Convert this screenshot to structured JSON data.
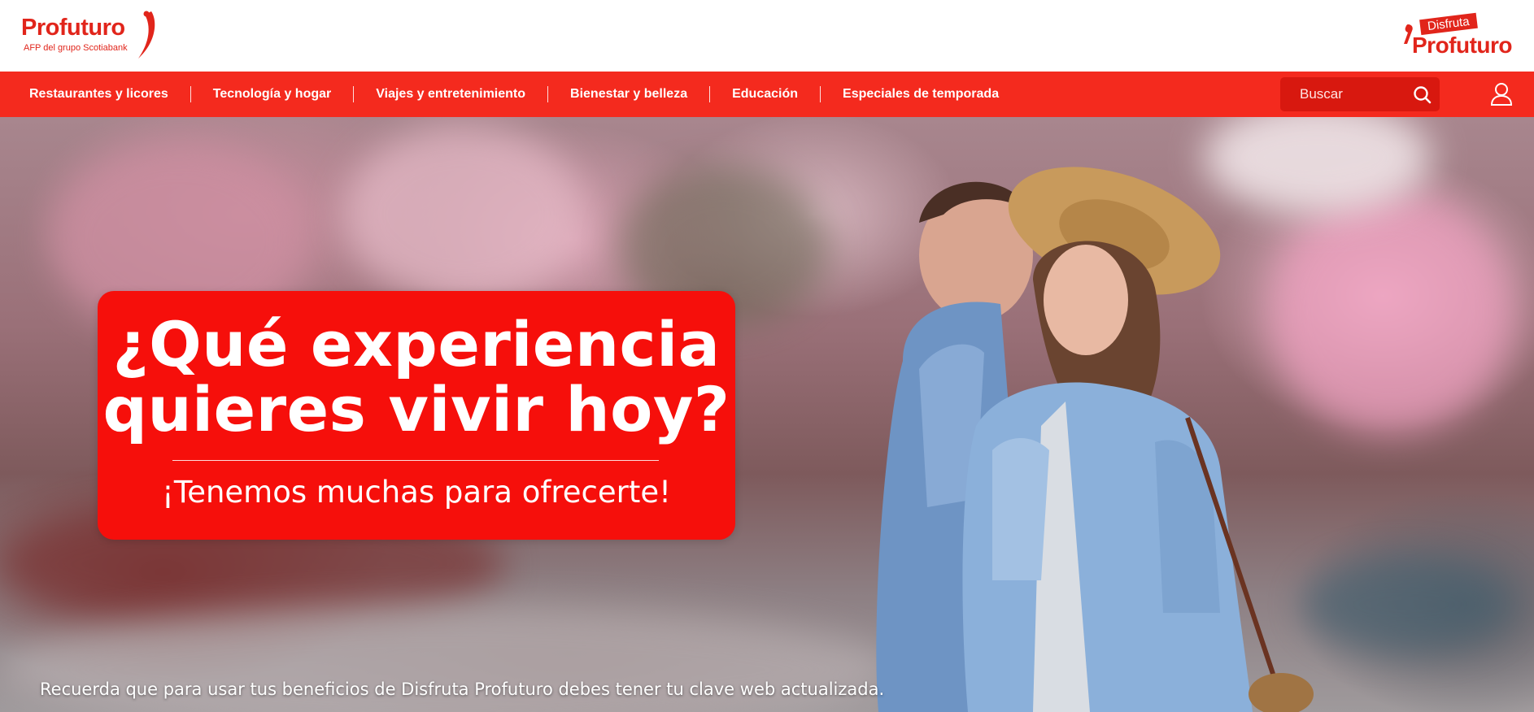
{
  "header": {
    "brand": {
      "name": "Profuturo",
      "subtitle": "AFP del grupo Scotiabank"
    },
    "program_logo": {
      "tag": "Disfruta",
      "name": "Profuturo"
    }
  },
  "nav": {
    "items": [
      {
        "label": "Restaurantes y licores"
      },
      {
        "label": "Tecnología y hogar"
      },
      {
        "label": "Viajes y entretenimiento"
      },
      {
        "label": "Bienestar y belleza"
      },
      {
        "label": "Educación"
      },
      {
        "label": "Especiales de temporada"
      }
    ],
    "search": {
      "placeholder": "Buscar",
      "icon": "search-icon"
    },
    "user_icon": "user-icon"
  },
  "hero": {
    "title_line1": "¿Qué experiencia",
    "title_line2": "quieres vivir hoy?",
    "subtitle": "¡Tenemos muchas para ofrecerte!",
    "note": "Recuerda que para usar tus beneficios de Disfruta Profuturo debes tener tu clave web actualizada."
  },
  "colors": {
    "brand_red": "#e1251b",
    "nav_red": "#f42a1e",
    "search_bg": "#d8180f",
    "promo_red": "#f60f0b"
  }
}
